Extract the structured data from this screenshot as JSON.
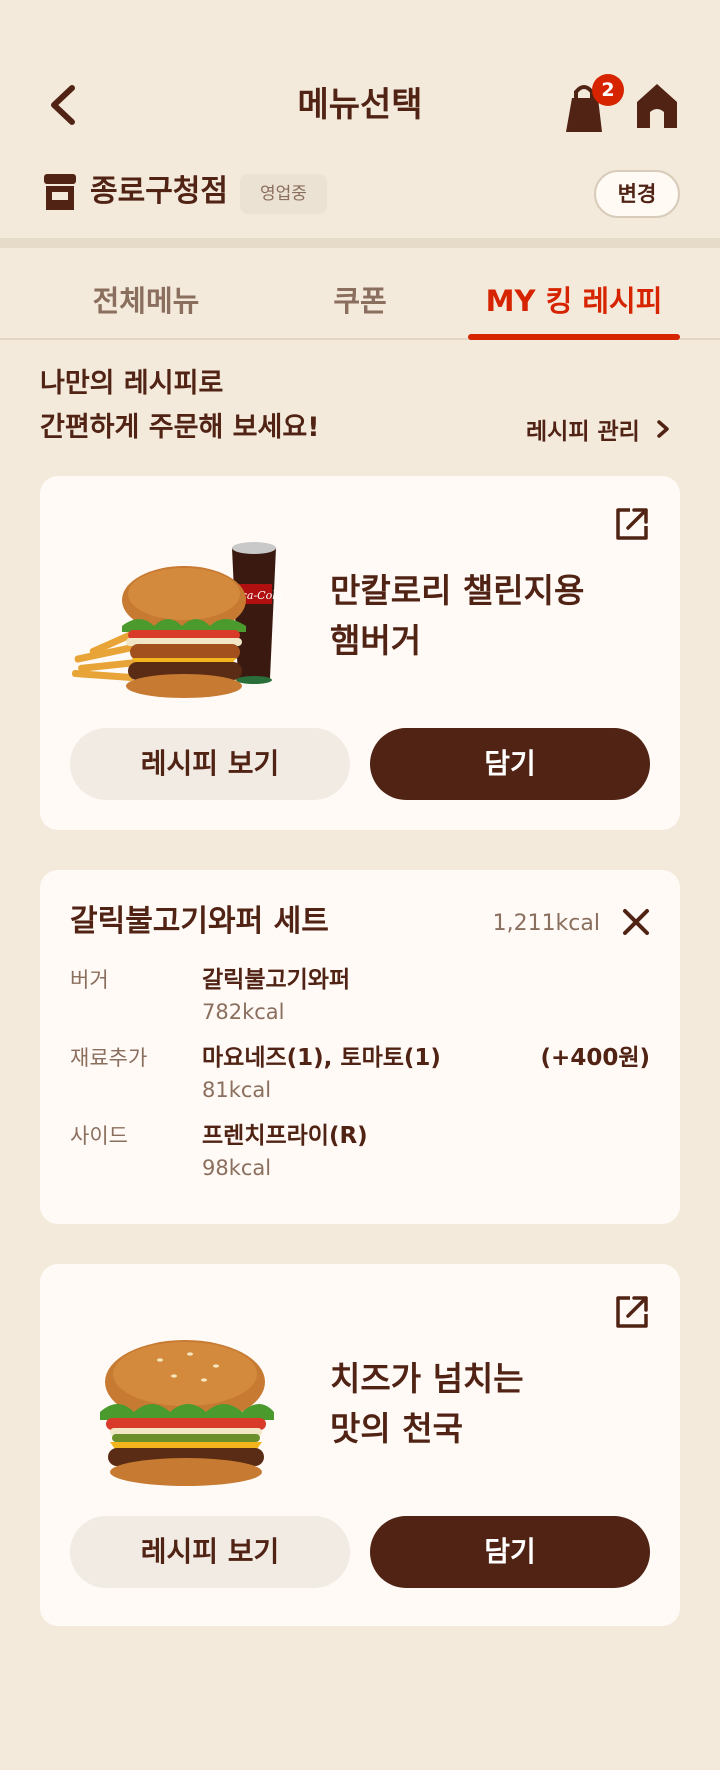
{
  "header": {
    "title": "메뉴선택",
    "cart_count": "2"
  },
  "store": {
    "name": "종로구청점",
    "status": "영업중",
    "change_label": "변경"
  },
  "tabs": [
    {
      "label": "전체메뉴",
      "active": false
    },
    {
      "label": "쿠폰",
      "active": false
    },
    {
      "label": "MY 킹 레시피",
      "active": true
    }
  ],
  "intro": {
    "line1": "나만의 레시피로",
    "line2": "간편하게 주문해 보세요!",
    "manage_label": "레시피 관리"
  },
  "recipes": [
    {
      "name_line1": "만칼로리 챌린지용",
      "name_line2": "햄버거",
      "view_label": "레시피 보기",
      "add_label": "담기"
    },
    {
      "name_line1": "치즈가 넘치는",
      "name_line2": "맛의 천국",
      "view_label": "레시피 보기",
      "add_label": "담기"
    }
  ],
  "set_card": {
    "title": "갈릭불고기와퍼 세트",
    "total_kcal": "1,211kcal",
    "options": [
      {
        "label": "버거",
        "name": "갈릭불고기와퍼",
        "kcal": "782kcal",
        "price": ""
      },
      {
        "label": "재료추가",
        "name": "마요네즈(1), 토마토(1)",
        "kcal": "81kcal",
        "price": "(+400원)"
      },
      {
        "label": "사이드",
        "name": "프렌치프라이(R)",
        "kcal": "98kcal",
        "price": ""
      }
    ]
  },
  "colors": {
    "background": "#f4eadc",
    "brand_brown": "#502314",
    "accent_red": "#d62300",
    "card": "#fffaf6"
  },
  "icons": [
    "back-chevron-icon",
    "shopping-bag-icon",
    "home-icon",
    "store-icon",
    "share-icon",
    "close-icon",
    "chevron-right-icon"
  ]
}
